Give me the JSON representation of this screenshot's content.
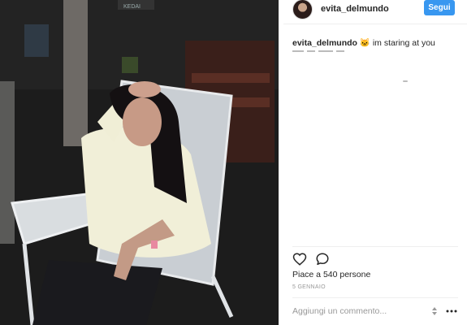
{
  "post": {
    "username": "evita_delmundo",
    "follow_label": "Segui",
    "caption_user": "evita_delmundo",
    "caption_text": "🐱 im staring at you",
    "likes_text": "Piace a 540 persone",
    "date_text": "5 GENNAIO",
    "comment_placeholder": "Aggiungi un commento..."
  },
  "photo_sign": "KEDAI",
  "colors": {
    "accent": "#3897f0",
    "text": "#262626",
    "muted": "#999999"
  },
  "icons": {
    "like": "heart-icon",
    "comment": "comment-icon",
    "sort": "sort-arrows-icon",
    "more": "more-dots-icon"
  }
}
